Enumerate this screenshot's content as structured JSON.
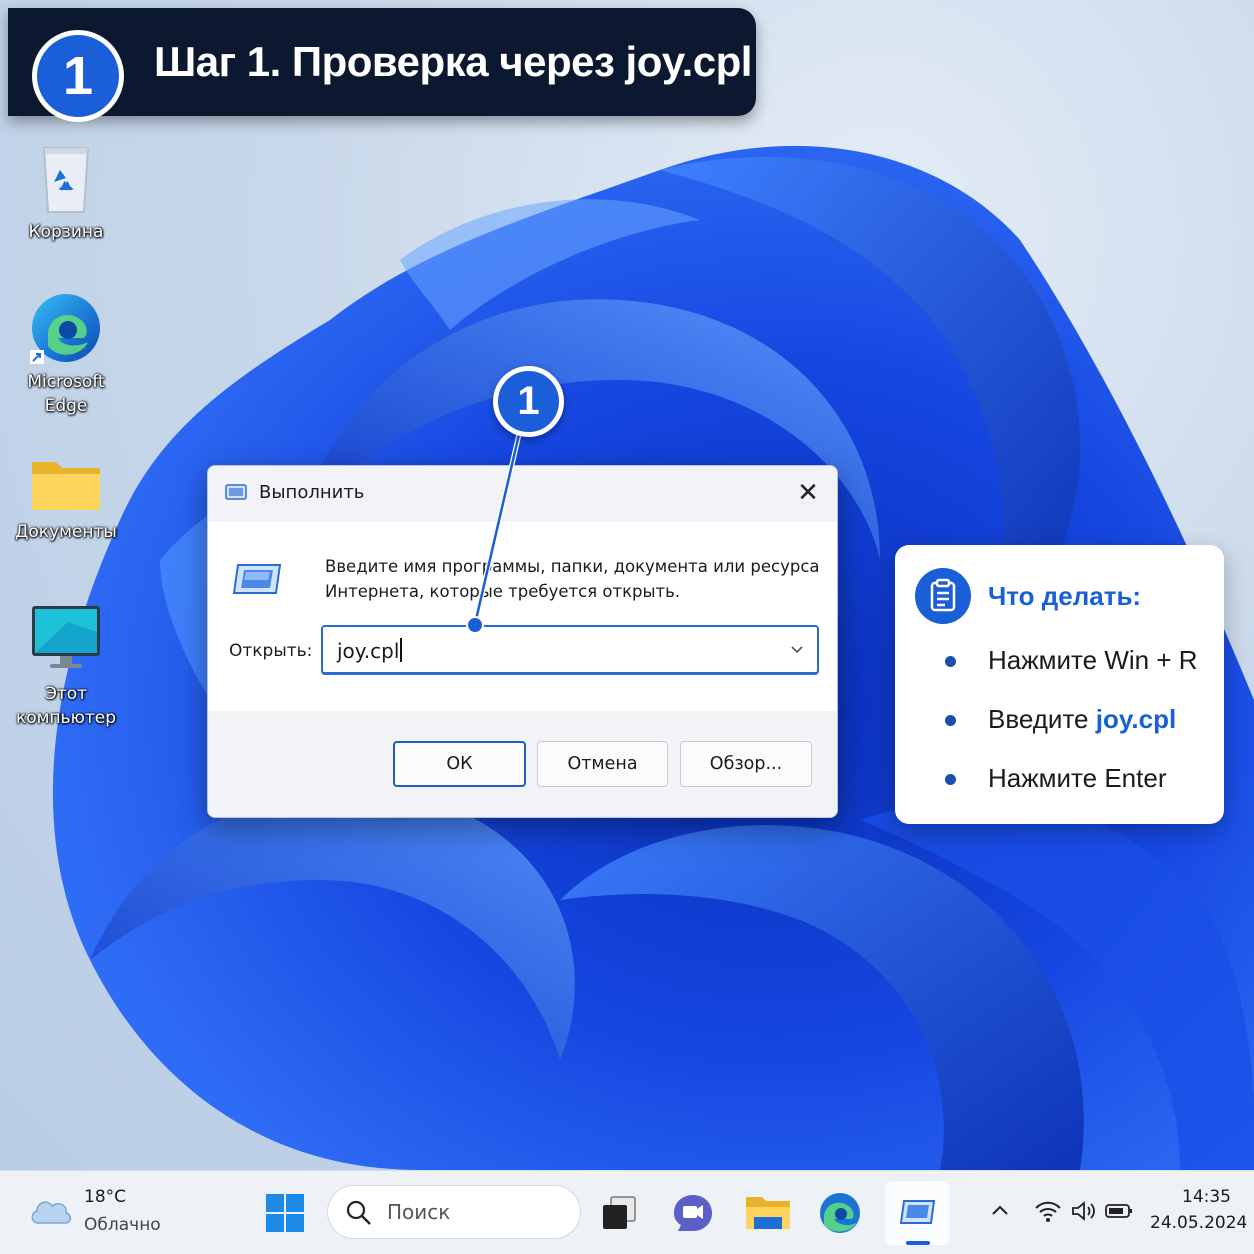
{
  "banner": {
    "step_number": "1",
    "title": "Шаг 1. Проверка через joy.cpl"
  },
  "desktop": {
    "icons": [
      {
        "label": "Корзина",
        "icon": "recycle-bin-icon"
      },
      {
        "label": "Microsoft Edge",
        "icon": "edge-icon"
      },
      {
        "label": "Документы",
        "icon": "folder-icon"
      },
      {
        "label": "Этот компьютер",
        "icon": "computer-icon"
      }
    ]
  },
  "run_dialog": {
    "title": "Выполнить",
    "description": "Введите имя программы, папки, документа или ресурса Интернета, которые требуется открыть.",
    "open_label": "Открыть:",
    "input_value": "joy.cpl",
    "buttons": {
      "ok": "ОК",
      "cancel": "Отмена",
      "browse": "Обзор..."
    }
  },
  "marker": {
    "number": "1"
  },
  "info_card": {
    "title": "Что делать:",
    "items": [
      {
        "text": "Нажмите Win + R"
      },
      {
        "prefix": "Введите ",
        "highlight": "joy.cpl"
      },
      {
        "text": "Нажмите Enter"
      }
    ]
  },
  "taskbar": {
    "weather": {
      "temp": "18°C",
      "desc": "Облачно"
    },
    "search_placeholder": "Поиск",
    "clock": {
      "time": "14:35",
      "date": "24.05.2024"
    }
  },
  "colors": {
    "accent": "#1a5fd8",
    "banner_bg": "#0c1730",
    "taskbar_bg": "#eef1f6"
  }
}
